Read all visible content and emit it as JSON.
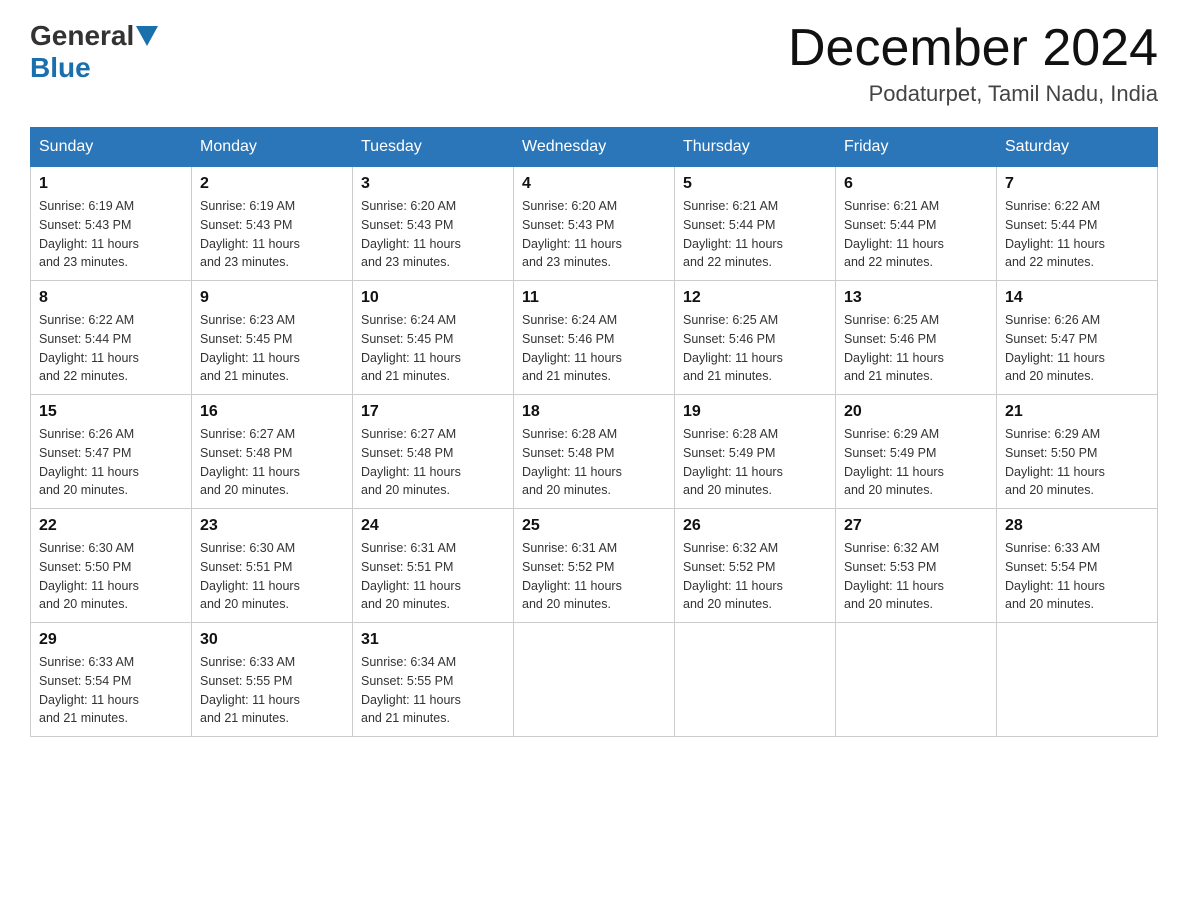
{
  "header": {
    "logo": {
      "general": "General",
      "blue": "Blue"
    },
    "title": "December 2024",
    "location": "Podaturpet, Tamil Nadu, India"
  },
  "days_of_week": [
    "Sunday",
    "Monday",
    "Tuesday",
    "Wednesday",
    "Thursday",
    "Friday",
    "Saturday"
  ],
  "weeks": [
    [
      {
        "day": "1",
        "sunrise": "6:19 AM",
        "sunset": "5:43 PM",
        "daylight": "11 hours and 23 minutes."
      },
      {
        "day": "2",
        "sunrise": "6:19 AM",
        "sunset": "5:43 PM",
        "daylight": "11 hours and 23 minutes."
      },
      {
        "day": "3",
        "sunrise": "6:20 AM",
        "sunset": "5:43 PM",
        "daylight": "11 hours and 23 minutes."
      },
      {
        "day": "4",
        "sunrise": "6:20 AM",
        "sunset": "5:43 PM",
        "daylight": "11 hours and 23 minutes."
      },
      {
        "day": "5",
        "sunrise": "6:21 AM",
        "sunset": "5:44 PM",
        "daylight": "11 hours and 22 minutes."
      },
      {
        "day": "6",
        "sunrise": "6:21 AM",
        "sunset": "5:44 PM",
        "daylight": "11 hours and 22 minutes."
      },
      {
        "day": "7",
        "sunrise": "6:22 AM",
        "sunset": "5:44 PM",
        "daylight": "11 hours and 22 minutes."
      }
    ],
    [
      {
        "day": "8",
        "sunrise": "6:22 AM",
        "sunset": "5:44 PM",
        "daylight": "11 hours and 22 minutes."
      },
      {
        "day": "9",
        "sunrise": "6:23 AM",
        "sunset": "5:45 PM",
        "daylight": "11 hours and 21 minutes."
      },
      {
        "day": "10",
        "sunrise": "6:24 AM",
        "sunset": "5:45 PM",
        "daylight": "11 hours and 21 minutes."
      },
      {
        "day": "11",
        "sunrise": "6:24 AM",
        "sunset": "5:46 PM",
        "daylight": "11 hours and 21 minutes."
      },
      {
        "day": "12",
        "sunrise": "6:25 AM",
        "sunset": "5:46 PM",
        "daylight": "11 hours and 21 minutes."
      },
      {
        "day": "13",
        "sunrise": "6:25 AM",
        "sunset": "5:46 PM",
        "daylight": "11 hours and 21 minutes."
      },
      {
        "day": "14",
        "sunrise": "6:26 AM",
        "sunset": "5:47 PM",
        "daylight": "11 hours and 20 minutes."
      }
    ],
    [
      {
        "day": "15",
        "sunrise": "6:26 AM",
        "sunset": "5:47 PM",
        "daylight": "11 hours and 20 minutes."
      },
      {
        "day": "16",
        "sunrise": "6:27 AM",
        "sunset": "5:48 PM",
        "daylight": "11 hours and 20 minutes."
      },
      {
        "day": "17",
        "sunrise": "6:27 AM",
        "sunset": "5:48 PM",
        "daylight": "11 hours and 20 minutes."
      },
      {
        "day": "18",
        "sunrise": "6:28 AM",
        "sunset": "5:48 PM",
        "daylight": "11 hours and 20 minutes."
      },
      {
        "day": "19",
        "sunrise": "6:28 AM",
        "sunset": "5:49 PM",
        "daylight": "11 hours and 20 minutes."
      },
      {
        "day": "20",
        "sunrise": "6:29 AM",
        "sunset": "5:49 PM",
        "daylight": "11 hours and 20 minutes."
      },
      {
        "day": "21",
        "sunrise": "6:29 AM",
        "sunset": "5:50 PM",
        "daylight": "11 hours and 20 minutes."
      }
    ],
    [
      {
        "day": "22",
        "sunrise": "6:30 AM",
        "sunset": "5:50 PM",
        "daylight": "11 hours and 20 minutes."
      },
      {
        "day": "23",
        "sunrise": "6:30 AM",
        "sunset": "5:51 PM",
        "daylight": "11 hours and 20 minutes."
      },
      {
        "day": "24",
        "sunrise": "6:31 AM",
        "sunset": "5:51 PM",
        "daylight": "11 hours and 20 minutes."
      },
      {
        "day": "25",
        "sunrise": "6:31 AM",
        "sunset": "5:52 PM",
        "daylight": "11 hours and 20 minutes."
      },
      {
        "day": "26",
        "sunrise": "6:32 AM",
        "sunset": "5:52 PM",
        "daylight": "11 hours and 20 minutes."
      },
      {
        "day": "27",
        "sunrise": "6:32 AM",
        "sunset": "5:53 PM",
        "daylight": "11 hours and 20 minutes."
      },
      {
        "day": "28",
        "sunrise": "6:33 AM",
        "sunset": "5:54 PM",
        "daylight": "11 hours and 20 minutes."
      }
    ],
    [
      {
        "day": "29",
        "sunrise": "6:33 AM",
        "sunset": "5:54 PM",
        "daylight": "11 hours and 21 minutes."
      },
      {
        "day": "30",
        "sunrise": "6:33 AM",
        "sunset": "5:55 PM",
        "daylight": "11 hours and 21 minutes."
      },
      {
        "day": "31",
        "sunrise": "6:34 AM",
        "sunset": "5:55 PM",
        "daylight": "11 hours and 21 minutes."
      },
      null,
      null,
      null,
      null
    ]
  ],
  "sunrise_label": "Sunrise:",
  "sunset_label": "Sunset:",
  "daylight_label": "Daylight:"
}
